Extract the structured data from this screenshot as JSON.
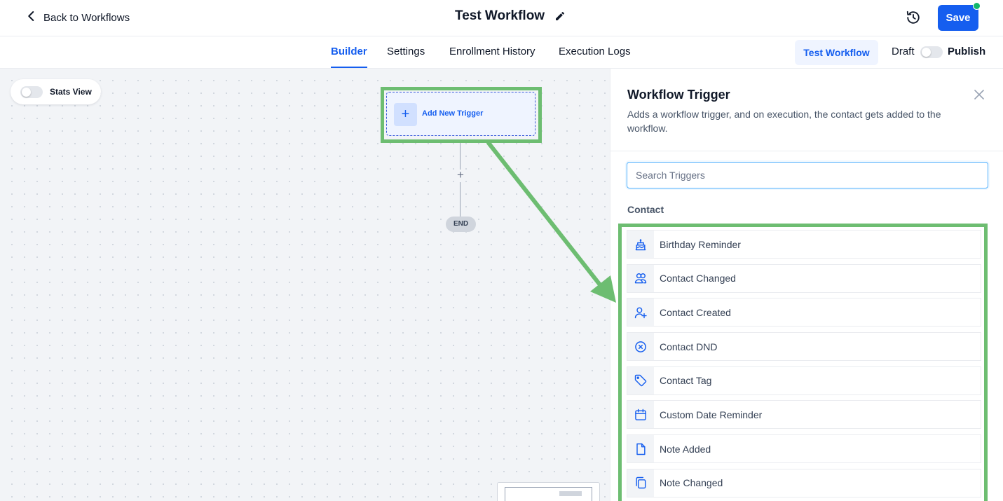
{
  "header": {
    "back_label": "Back to Workflows",
    "title": "Test Workflow",
    "save_label": "Save"
  },
  "tabs": [
    {
      "label": "Builder",
      "active": true
    },
    {
      "label": "Settings",
      "active": false
    },
    {
      "label": "Enrollment History",
      "active": false
    },
    {
      "label": "Execution Logs",
      "active": false
    }
  ],
  "actions": {
    "test_label": "Test Workflow",
    "draft_label": "Draft",
    "publish_label": "Publish",
    "published": false
  },
  "canvas": {
    "stats_label": "Stats View",
    "stats_on": false,
    "trigger_label": "Add New Trigger",
    "add_step_symbol": "+",
    "end_label": "END"
  },
  "panel": {
    "title": "Workflow Trigger",
    "description": "Adds a workflow trigger, and on execution, the contact gets added to the workflow.",
    "search_placeholder": "Search Triggers",
    "category": "Contact",
    "items": [
      {
        "label": "Birthday Reminder",
        "icon": "cake-icon"
      },
      {
        "label": "Contact Changed",
        "icon": "users-icon"
      },
      {
        "label": "Contact Created",
        "icon": "user-plus-icon"
      },
      {
        "label": "Contact DND",
        "icon": "x-circle-icon"
      },
      {
        "label": "Contact Tag",
        "icon": "tag-icon"
      },
      {
        "label": "Custom Date Reminder",
        "icon": "calendar-icon"
      },
      {
        "label": "Note Added",
        "icon": "file-icon"
      },
      {
        "label": "Note Changed",
        "icon": "copy-icon"
      }
    ]
  },
  "colors": {
    "primary": "#155eef",
    "highlight": "#6dbd71",
    "status_dot": "#12b76a"
  }
}
